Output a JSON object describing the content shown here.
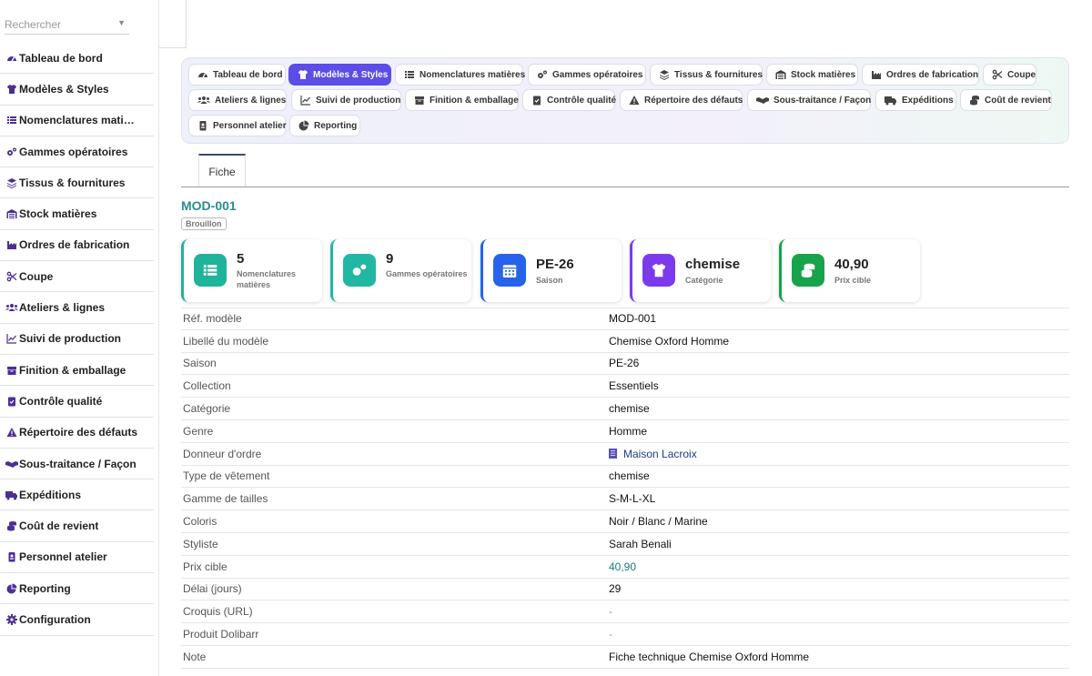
{
  "search": {
    "placeholder": "Rechercher"
  },
  "sidebar": {
    "items": [
      {
        "label": "Tableau de bord",
        "icon": "gauge-icon"
      },
      {
        "label": "Modèles & Styles",
        "icon": "shirt-icon"
      },
      {
        "label": "Nomenclatures mati…",
        "icon": "list-icon"
      },
      {
        "label": "Gammes opératoires",
        "icon": "cogs-icon"
      },
      {
        "label": "Tissus & fournitures",
        "icon": "layers-icon"
      },
      {
        "label": "Stock matières",
        "icon": "warehouse-icon"
      },
      {
        "label": "Ordres de fabrication",
        "icon": "industry-icon"
      },
      {
        "label": "Coupe",
        "icon": "scissors-icon"
      },
      {
        "label": "Ateliers & lignes",
        "icon": "users-icon"
      },
      {
        "label": "Suivi de production",
        "icon": "chart-line-icon"
      },
      {
        "label": "Finition & emballage",
        "icon": "box-icon"
      },
      {
        "label": "Contrôle qualité",
        "icon": "clipboard-check-icon"
      },
      {
        "label": "Répertoire des défauts",
        "icon": "warning-icon"
      },
      {
        "label": "Sous-traitance / Façon",
        "icon": "handshake-icon"
      },
      {
        "label": "Expéditions",
        "icon": "truck-icon"
      },
      {
        "label": "Coût de revient",
        "icon": "coins-icon"
      },
      {
        "label": "Personnel atelier",
        "icon": "id-badge-icon"
      },
      {
        "label": "Reporting",
        "icon": "pie-chart-icon"
      },
      {
        "label": "Configuration",
        "icon": "gear-icon"
      }
    ]
  },
  "module_tabs": [
    {
      "label": "Tableau de bord",
      "icon": "gauge-icon"
    },
    {
      "label": "Modèles & Styles",
      "icon": "shirt-icon",
      "active": true
    },
    {
      "label": "Nomenclatures matières",
      "icon": "list-icon"
    },
    {
      "label": "Gammes opératoires",
      "icon": "cogs-icon"
    },
    {
      "label": "Tissus & fournitures",
      "icon": "layers-icon"
    },
    {
      "label": "Stock matières",
      "icon": "warehouse-icon"
    },
    {
      "label": "Ordres de fabrication",
      "icon": "industry-icon"
    },
    {
      "label": "Coupe",
      "icon": "scissors-icon"
    },
    {
      "label": "Ateliers & lignes",
      "icon": "users-icon"
    },
    {
      "label": "Suivi de production",
      "icon": "chart-line-icon"
    },
    {
      "label": "Finition & emballage",
      "icon": "box-icon"
    },
    {
      "label": "Contrôle qualité",
      "icon": "clipboard-check-icon"
    },
    {
      "label": "Répertoire des défauts",
      "icon": "warning-icon"
    },
    {
      "label": "Sous-traitance / Façon",
      "icon": "handshake-icon"
    },
    {
      "label": "Expéditions",
      "icon": "truck-icon"
    },
    {
      "label": "Coût de revient",
      "icon": "coins-icon"
    },
    {
      "label": "Personnel atelier",
      "icon": "id-badge-icon"
    },
    {
      "label": "Reporting",
      "icon": "pie-chart-icon"
    }
  ],
  "page_tabs": {
    "fiche": "Fiche"
  },
  "record": {
    "ref": "MOD-001",
    "status": "Brouillon"
  },
  "cards": [
    {
      "value": "5",
      "label": "Nomenclatures matières",
      "icon": "list-icon",
      "color": "#1fb39a"
    },
    {
      "value": "9",
      "label": "Gammes opératoires",
      "icon": "cogs-icon",
      "color": "#21b7a3"
    },
    {
      "value": "PE-26",
      "label": "Saison",
      "icon": "calendar-icon",
      "color": "#2563eb"
    },
    {
      "value": "chemise",
      "label": "Catégorie",
      "icon": "shirt-icon",
      "color": "#7c3aed"
    },
    {
      "value": "40,90",
      "label": "Prix cible",
      "icon": "coins-icon",
      "color": "#16a34a"
    }
  ],
  "fields": [
    {
      "label": "Réf. modèle",
      "value": "MOD-001"
    },
    {
      "label": "Libellé du modèle",
      "value": "Chemise Oxford Homme"
    },
    {
      "label": "Saison",
      "value": "PE-26"
    },
    {
      "label": "Collection",
      "value": "Essentiels"
    },
    {
      "label": "Catégorie",
      "value": "chemise"
    },
    {
      "label": "Genre",
      "value": "Homme"
    },
    {
      "label": "Donneur d'ordre",
      "value": "Maison Lacroix",
      "link": true
    },
    {
      "label": "Type de vêtement",
      "value": "chemise"
    },
    {
      "label": "Gamme de tailles",
      "value": "S-M-L-XL"
    },
    {
      "label": "Coloris",
      "value": "Noir / Blanc / Marine"
    },
    {
      "label": "Styliste",
      "value": "Sarah Benali"
    },
    {
      "label": "Prix cible",
      "value": "40,90",
      "teal": true
    },
    {
      "label": "Délai (jours)",
      "value": "29"
    },
    {
      "label": "Croquis (URL)",
      "value": "-",
      "muted": true
    },
    {
      "label": "Produit Dolibarr",
      "value": "-",
      "muted": true
    },
    {
      "label": "Note",
      "value": "Fiche technique Chemise Oxford Homme"
    }
  ]
}
